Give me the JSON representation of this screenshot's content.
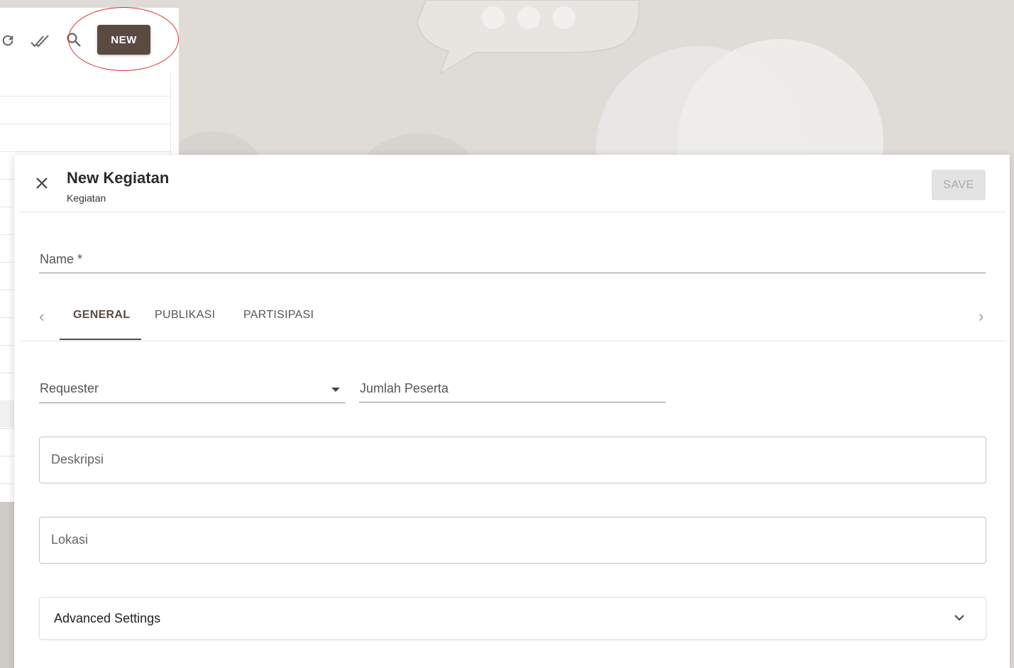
{
  "list_panel": {
    "new_button_label": "NEW",
    "icons": [
      "refresh-icon",
      "done-all-icon",
      "search-icon"
    ]
  },
  "dialog": {
    "title": "New Kegiatan",
    "subtitle": "Kegiatan",
    "save_label": "SAVE",
    "name_label": "Name *",
    "tabs": [
      {
        "label": "GENERAL"
      },
      {
        "label": "PUBLIKASI"
      },
      {
        "label": "PARTISIPASI"
      }
    ],
    "requester_label": "Requester",
    "jumlah_peserta_label": "Jumlah Peserta",
    "deskripsi_placeholder": "Deskripsi",
    "lokasi_placeholder": "Lokasi",
    "advanced_settings_label": "Advanced Settings"
  },
  "colors": {
    "accent": "#5a4a42",
    "background": "#dfdcd8",
    "callout": "#d9322e"
  }
}
